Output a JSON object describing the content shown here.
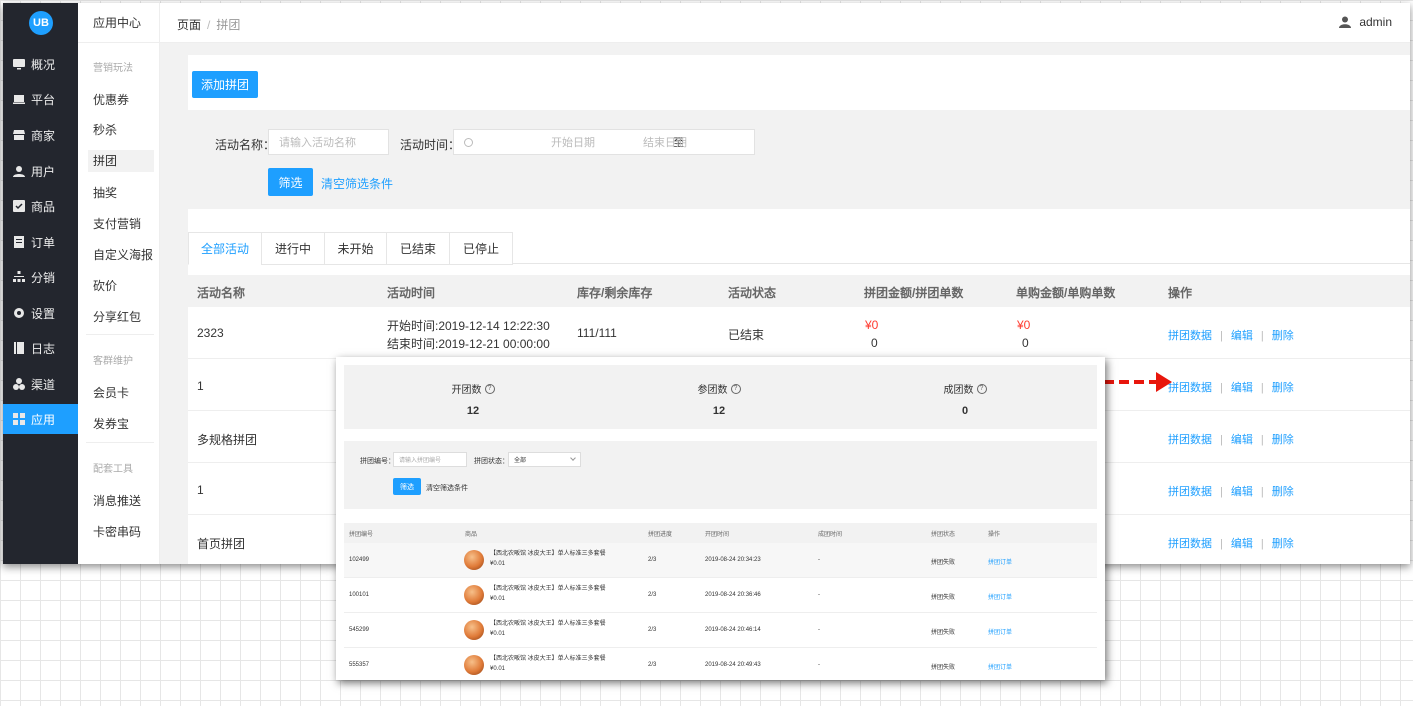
{
  "sidebar": {
    "logo": "UB",
    "items": [
      {
        "label": "概况",
        "icon": "monitor-icon"
      },
      {
        "label": "平台",
        "icon": "laptop-icon"
      },
      {
        "label": "商家",
        "icon": "store-icon"
      },
      {
        "label": "用户",
        "icon": "user-icon"
      },
      {
        "label": "商品",
        "icon": "box-icon"
      },
      {
        "label": "订单",
        "icon": "order-icon"
      },
      {
        "label": "分销",
        "icon": "sitemap-icon"
      },
      {
        "label": "设置",
        "icon": "gear-icon"
      },
      {
        "label": "日志",
        "icon": "book-icon"
      },
      {
        "label": "渠道",
        "icon": "cubes-icon"
      },
      {
        "label": "应用",
        "icon": "grid-icon",
        "active": true
      }
    ]
  },
  "submenu": {
    "title": "应用中心",
    "group1": "营销玩法",
    "items1": [
      "优惠券",
      "秒杀",
      "拼团",
      "抽奖",
      "支付营销",
      "自定义海报",
      "砍价",
      "分享红包"
    ],
    "group2": "客群维护",
    "items2": [
      "会员卡",
      "发券宝"
    ],
    "group3": "配套工具",
    "items3": [
      "消息推送",
      "卡密串码"
    ]
  },
  "header": {
    "crumb_root": "页面",
    "crumb_sep": "/",
    "crumb_current": "拼团",
    "user": "admin"
  },
  "toolbar": {
    "add_label": "添加拼团"
  },
  "filter": {
    "name_label": "活动名称：",
    "name_placeholder": "请输入活动名称",
    "time_label": "活动时间：",
    "start_placeholder": "开始日期",
    "to": "至",
    "end_placeholder": "结束日期",
    "submit": "筛选",
    "clear": "清空筛选条件"
  },
  "tabs": [
    "全部活动",
    "进行中",
    "未开始",
    "已结束",
    "已停止"
  ],
  "table": {
    "headers": [
      "活动名称",
      "活动时间",
      "库存/剩余库存",
      "活动状态",
      "拼团金额/拼团单数",
      "单购金额/单购单数",
      "操作"
    ],
    "rows": [
      {
        "name": "2323",
        "start": "开始时间:2019-12-14 12:22:30",
        "end": "结束时间:2019-12-21 00:00:00",
        "stock": "111/111",
        "status": "已结束",
        "group_amount": "¥0",
        "group_count": "0",
        "single_amount": "¥0",
        "single_count": "0"
      },
      {
        "name": "1"
      },
      {
        "name": "多规格拼团"
      },
      {
        "name": "1"
      },
      {
        "name": "首页拼团"
      }
    ],
    "ops": {
      "data": "拼团数据",
      "edit": "编辑",
      "delete": "删除",
      "sep": "|"
    }
  },
  "popup": {
    "stats": [
      {
        "label": "开团数",
        "value": "12"
      },
      {
        "label": "参团数",
        "value": "12"
      },
      {
        "label": "成团数",
        "value": "0"
      }
    ],
    "help_glyph": "?",
    "filter": {
      "no_label": "拼团编号：",
      "no_placeholder": "请输入拼团编号",
      "status_label": "拼团状态：",
      "status_value": "全部",
      "submit": "筛选",
      "clear": "清空筛选条件"
    },
    "headers": [
      "拼团编号",
      "商品",
      "拼团进度",
      "开团时间",
      "成团时间",
      "拼团状态",
      "操作"
    ],
    "rows": [
      {
        "no": "102499",
        "goods": "【西北农畈馆 冰皮大王】单人标准三多套餐",
        "price": "¥0.01",
        "progress": "2/3",
        "open_time": "2019-08-24 20:34:23",
        "done_time": "-",
        "status": "拼团失败",
        "op": "拼团订单"
      },
      {
        "no": "100101",
        "goods": "【西北农畈馆 冰皮大王】单人标准三多套餐",
        "price": "¥0.01",
        "progress": "2/3",
        "open_time": "2019-08-24 20:36:46",
        "done_time": "-",
        "status": "拼团失败",
        "op": "拼团订单"
      },
      {
        "no": "545299",
        "goods": "【西北农畈馆 冰皮大王】单人标准三多套餐",
        "price": "¥0.01",
        "progress": "2/3",
        "open_time": "2019-08-24 20:46:14",
        "done_time": "-",
        "status": "拼团失败",
        "op": "拼团订单"
      },
      {
        "no": "555357",
        "goods": "【西北农畈馆 冰皮大王】单人标准三多套餐",
        "price": "¥0.01",
        "progress": "2/3",
        "open_time": "2019-08-24 20:49:43",
        "done_time": "-",
        "status": "拼团失败",
        "op": "拼团订单"
      }
    ]
  },
  "colors": {
    "accent": "#1e9fff",
    "sidebar_bg": "#23262e",
    "price_red": "#ff3b30",
    "arrow_red": "#e8160c"
  }
}
